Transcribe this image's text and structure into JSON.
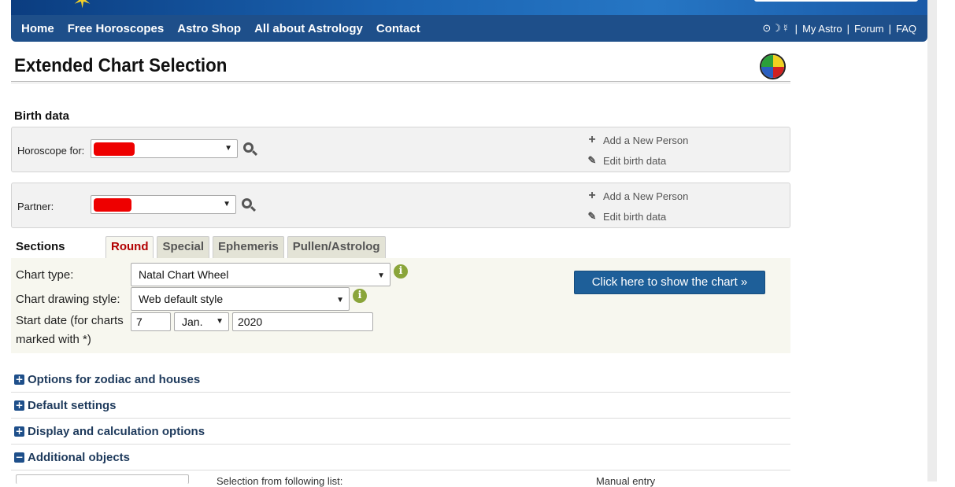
{
  "nav": {
    "items": [
      "Home",
      "Free Horoscopes",
      "Astro Shop",
      "All about Astrology",
      "Contact"
    ],
    "symbols": "⊙☽☿",
    "right_links": [
      "My Astro",
      "Forum",
      "FAQ"
    ]
  },
  "page": {
    "title": "Extended Chart Selection"
  },
  "birth_data": {
    "heading": "Birth data",
    "horoscope_label": "Horoscope for:",
    "partner_label": "Partner:",
    "add_person": "Add a New Person",
    "edit_birth": "Edit birth data"
  },
  "sections": {
    "label": "Sections",
    "tabs": [
      "Round",
      "Special",
      "Ephemeris",
      "Pullen/Astrolog"
    ],
    "active_tab": "Round"
  },
  "form": {
    "chart_type_label": "Chart type:",
    "chart_type_value": "Natal Chart Wheel",
    "drawing_style_label": "Chart drawing style:",
    "drawing_style_value": "Web default style",
    "start_date_label_1": "Start date (for charts",
    "start_date_label_2": "marked with *)",
    "day": "7",
    "month": "Jan.",
    "year": "2020",
    "show_button": "Click here to show the chart »"
  },
  "collapsibles": [
    {
      "label": "Options for zodiac and houses",
      "expanded": false
    },
    {
      "label": "Default settings",
      "expanded": false
    },
    {
      "label": "Display and calculation options",
      "expanded": false
    },
    {
      "label": "Additional objects",
      "expanded": true
    }
  ],
  "bottom": {
    "text1": "Selection from following list:",
    "text2": "Manual entry"
  },
  "colors": {
    "nav_bg": "#1e4f8a",
    "active_tab": "#b20000",
    "primary_button": "#1e5f99",
    "info_icon": "#8aa53a"
  }
}
